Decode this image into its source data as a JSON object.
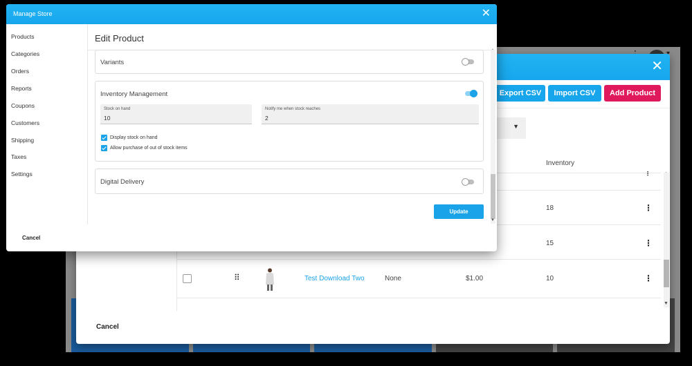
{
  "back_app": {
    "more_icon": "more-vertical-icon",
    "caret_icon": "caret-down-icon"
  },
  "back_modal": {
    "close_icon": "close-icon",
    "export_label": "Export CSV",
    "import_label": "Import CSV",
    "add_label": "Add Product",
    "inventory_header": "Inventory",
    "rows": [
      {
        "inventory": "18"
      },
      {
        "inventory": "15"
      },
      {
        "name": "Test Download Two",
        "variation": "None",
        "price": "$1.00",
        "inventory": "10"
      }
    ],
    "cancel_label": "Cancel",
    "colors": {
      "header": "#17a6ec",
      "add_button": "#e0185c",
      "link": "#1aa3e8"
    }
  },
  "front_modal": {
    "title": "Manage Store",
    "close_icon": "close-icon",
    "sidebar": {
      "items": [
        "Products",
        "Categories",
        "Orders",
        "Reports",
        "Coupons",
        "Customers",
        "Shipping",
        "Taxes",
        "Settings"
      ]
    },
    "edit_title": "Edit Product",
    "variants": {
      "title": "Variants",
      "enabled": false
    },
    "inventory": {
      "title": "Inventory Management",
      "enabled": true,
      "stock_label": "Stock on hand",
      "stock_value": "10",
      "notify_label": "Notify me when stock reaches",
      "notify_value": "2",
      "display_stock_label": "Display stock on hand",
      "display_stock_checked": true,
      "allow_oos_label": "Allow purchase of out of stock items",
      "allow_oos_checked": true
    },
    "digital": {
      "title": "Digital Delivery",
      "enabled": false
    },
    "update_label": "Update",
    "cancel_label": "Cancel"
  }
}
